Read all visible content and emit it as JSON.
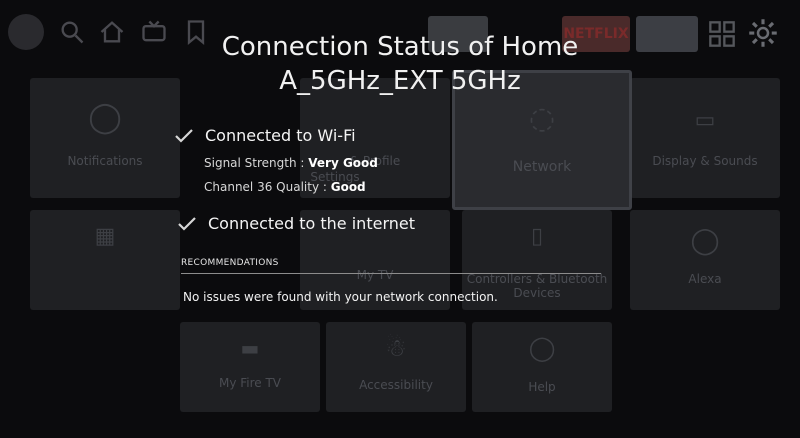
{
  "dialog": {
    "title_line1": "Connection Status of Home",
    "title_line2": "A_5GHz_EXT 5GHz",
    "wifi_status": "Connected to Wi-Fi",
    "signal_label": "Signal Strength : ",
    "signal_value": "Very Good",
    "channel_label": "Channel 36 Quality : ",
    "channel_value": "Good",
    "internet_status": "Connected to the internet",
    "recommendations_heading": "RECOMMENDATIONS",
    "recommendations_text": "No issues were found with your network connection."
  },
  "background": {
    "apps": [
      "NETFLIX"
    ],
    "tiles": {
      "notifications": "Notifications",
      "settings": "Settings",
      "profile_settings": "& Profile",
      "network": "Network",
      "display_sounds": "Display & Sounds",
      "my_tv": "My TV",
      "controllers": "Controllers & Bluetooth",
      "devices": "Devices",
      "alexa": "Alexa",
      "my_fire_tv": "My Fire TV",
      "accessibility": "Accessibility",
      "help": "Help"
    }
  },
  "colors": {
    "background": "#0b0b0d",
    "text": "#ffffff",
    "check": "#d6d6d6",
    "netflix_red": "#5a1a1a"
  },
  "icons": [
    "search-icon",
    "home-icon",
    "tv-icon",
    "bookmark-icon",
    "apps-icon",
    "gear-icon",
    "checkmark-icon"
  ]
}
